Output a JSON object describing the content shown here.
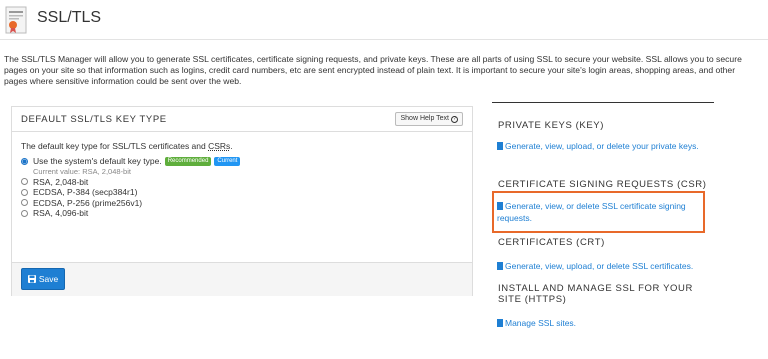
{
  "header": {
    "title": "SSL/TLS",
    "icon": "certificate-icon"
  },
  "intro": "The SSL/TLS Manager will allow you to generate SSL certificates, certificate signing requests, and private keys. These are all parts of using SSL to secure your website. SSL allows you to secure pages on your site so that information such as logins, credit card numbers, etc are sent encrypted instead of plain text. It is important to secure your site's login areas, shopping areas, and other pages where sensitive information could be sent over the web.",
  "panel": {
    "title": "DEFAULT SSL/TLS KEY TYPE",
    "help_button": "Show Help Text",
    "description_prefix": "The default key type for SSL/TLS certificates and ",
    "description_abbr": "CSRs",
    "description_suffix": ".",
    "options": [
      {
        "label": "Use the system's default key type.",
        "checked": true
      },
      {
        "label": "RSA, 2,048-bit",
        "checked": false
      },
      {
        "label": "ECDSA, P-384 (secp384r1)",
        "checked": false
      },
      {
        "label": "ECDSA, P-256 (prime256v1)",
        "checked": false
      },
      {
        "label": "RSA, 4,096-bit",
        "checked": false
      }
    ],
    "badge_recommended": "Recommended",
    "badge_current": "Current",
    "current_value": "Current value: RSA, 2,048-bit",
    "save_label": "Save"
  },
  "sidebar": {
    "sections": [
      {
        "heading": "PRIVATE KEYS (KEY)",
        "link": "Generate, view, upload, or delete your private keys."
      },
      {
        "heading": "CERTIFICATE SIGNING REQUESTS (CSR)",
        "link": "Generate, view, or delete SSL certificate signing requests."
      },
      {
        "heading": "CERTIFICATES (CRT)",
        "link": "Generate, view, upload, or delete SSL certificates."
      },
      {
        "heading": "INSTALL AND MANAGE SSL FOR YOUR SITE (HTTPS)",
        "link": "Manage SSL sites."
      }
    ]
  },
  "colors": {
    "accent": "#1e7fd3",
    "highlight": "#e8692a",
    "recommended": "#5fae3c",
    "current": "#2196f3"
  }
}
